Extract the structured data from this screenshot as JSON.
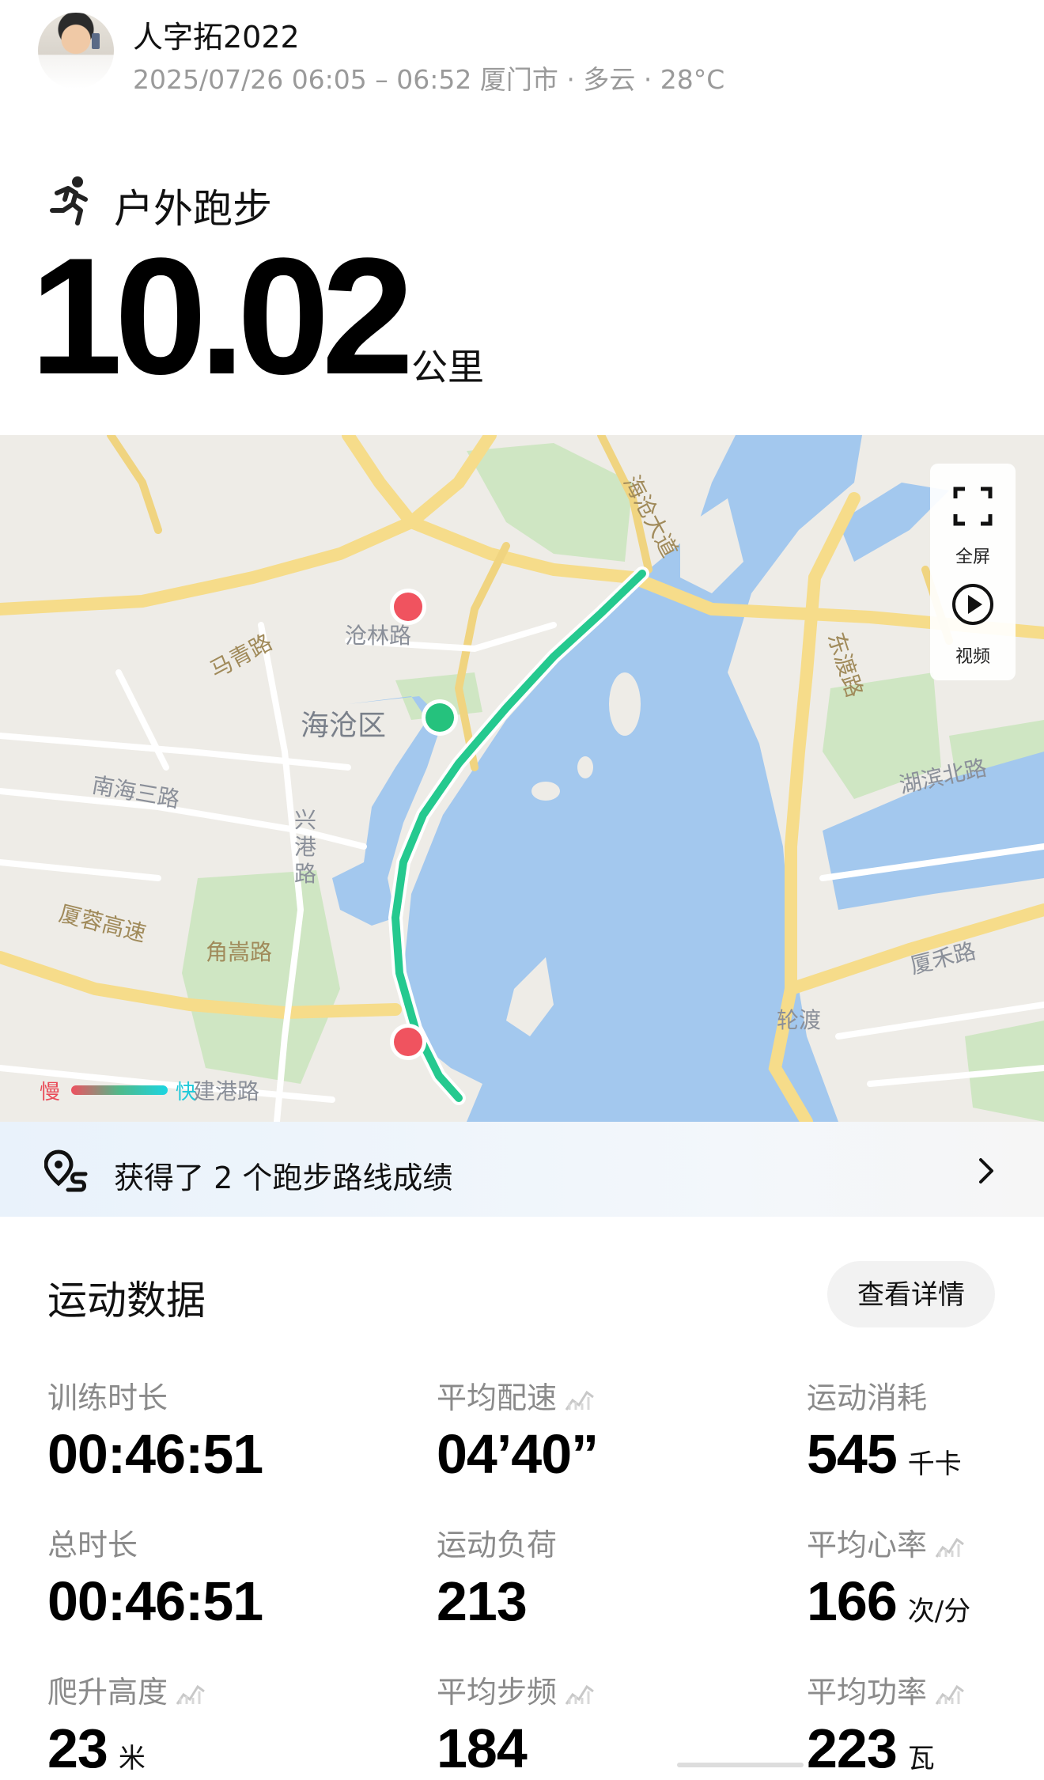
{
  "header": {
    "username": "人字拓2022",
    "meta": "2025/07/26 06:05 – 06:52 厦门市 · 多云 · 28°C"
  },
  "activity": {
    "type": "户外跑步",
    "distance": "10.02",
    "distance_unit": "公里"
  },
  "map": {
    "labels": {
      "cang_lin_lu": "沧林路",
      "ma_qing_lu": "马青路",
      "hai_cang_qu": "海沧区",
      "nan_hai_san_lu": "南海三路",
      "xing_gang_lu": "兴港路",
      "xia_rong_gao_su": "厦蓉高速",
      "jiao_song_lu": "角嵩路",
      "hai_cang_da_dao": "海沧大道",
      "dong_du_lu": "东渡路",
      "hu_bin_bei_lu": "湖滨北路",
      "xia_he_lu": "厦禾路",
      "lun_du": "轮渡",
      "jian_gang_lu": "建港路"
    },
    "controls": {
      "fullscreen_label": "全屏",
      "video_label": "视频"
    },
    "legend": {
      "slow": "慢",
      "fast": "快"
    }
  },
  "achievements": {
    "text": "获得了 2 个跑步路线成绩"
  },
  "stats": {
    "title": "运动数据",
    "detail_button": "查看详情",
    "items": [
      {
        "label": "训练时长",
        "value": "00:46:51",
        "unit": ""
      },
      {
        "label": "平均配速",
        "value": "04’40”",
        "unit": ""
      },
      {
        "label": "运动消耗",
        "value": "545",
        "unit": "千卡"
      },
      {
        "label": "总时长",
        "value": "00:46:51",
        "unit": ""
      },
      {
        "label": "运动负荷",
        "value": "213",
        "unit": ""
      },
      {
        "label": "平均心率",
        "value": "166",
        "unit": "次/分"
      },
      {
        "label": "爬升高度",
        "value": "23",
        "unit": "米"
      },
      {
        "label": "平均步频",
        "value": "184",
        "unit": ""
      },
      {
        "label": "平均功率",
        "value": "223",
        "unit": "瓦"
      }
    ]
  },
  "colors": {
    "route": "#25c98f",
    "start_marker": "#25c27d",
    "end_marker": "#f0535f",
    "water": "#a3c8ee",
    "green_area": "#cfe6c3",
    "major_road": "#f6dc8a"
  }
}
